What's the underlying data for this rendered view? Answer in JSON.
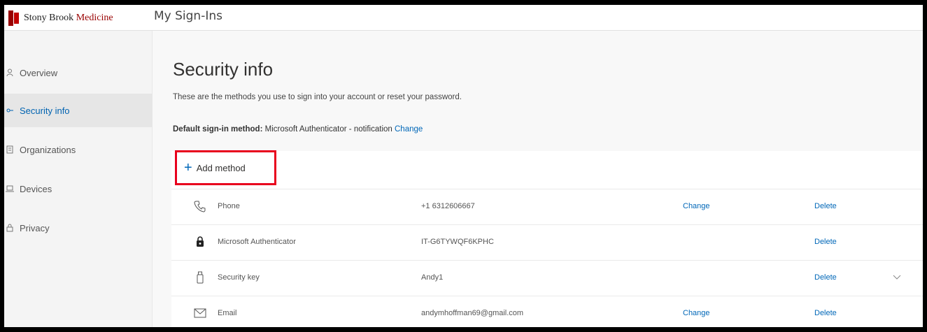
{
  "header": {
    "logo_text_part1": "Stony Brook",
    "logo_text_part2": "Medicine",
    "app_title": "My Sign-Ins"
  },
  "sidebar": {
    "items": [
      {
        "label": "Overview",
        "icon": "person-icon",
        "active": false
      },
      {
        "label": "Security info",
        "icon": "key-icon",
        "active": true
      },
      {
        "label": "Organizations",
        "icon": "building-icon",
        "active": false
      },
      {
        "label": "Devices",
        "icon": "laptop-icon",
        "active": false
      },
      {
        "label": "Privacy",
        "icon": "lock-icon",
        "active": false
      }
    ]
  },
  "main": {
    "title": "Security info",
    "description": "These are the methods you use to sign into your account or reset your password.",
    "default_label": "Default sign-in method:",
    "default_value": "Microsoft Authenticator - notification",
    "default_change": "Change",
    "add_method_label": "Add method",
    "methods": [
      {
        "icon": "phone-icon",
        "type": "Phone",
        "value": "+1 6312606667",
        "change": "Change",
        "delete": "Delete"
      },
      {
        "icon": "authenticator-icon",
        "type": "Microsoft Authenticator",
        "value": "IT-G6TYWQF6KPHC",
        "change": "",
        "delete": "Delete"
      },
      {
        "icon": "security-key-icon",
        "type": "Security key",
        "value": "Andy1",
        "change": "",
        "delete": "Delete",
        "expand": "chevron-down-icon"
      },
      {
        "icon": "email-icon",
        "type": "Email",
        "value": "andymhoffman69@gmail.com",
        "change": "Change",
        "delete": "Delete"
      }
    ]
  },
  "colors": {
    "accent": "#0067b8",
    "highlight_box": "#e8001d",
    "brand": "#990000"
  }
}
